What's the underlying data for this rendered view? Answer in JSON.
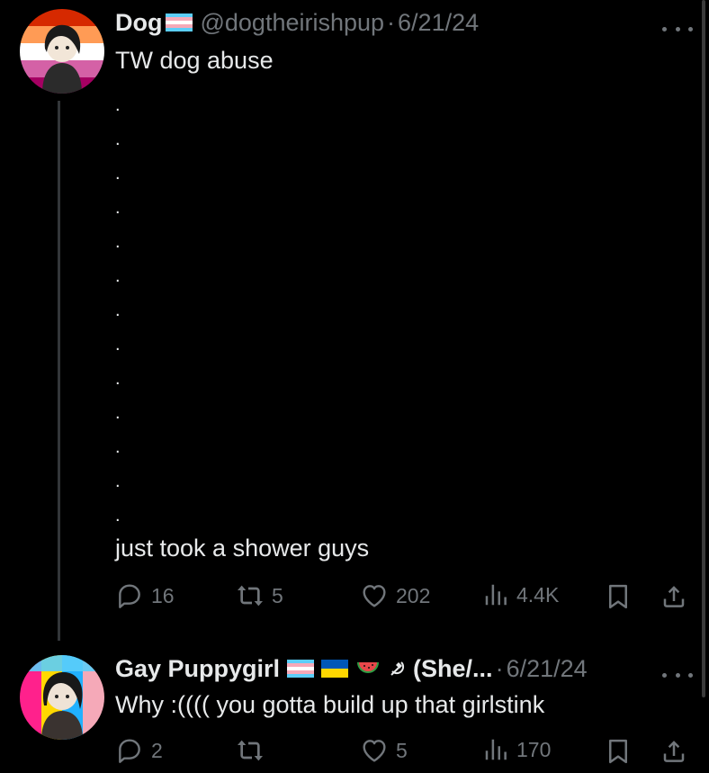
{
  "posts": [
    {
      "display_name": "Dog",
      "handle": "@dogtheirishpup",
      "separator": "·",
      "date": "6/21/24",
      "title_line": "TW dog abuse",
      "spacer_dots": [
        ".",
        ".",
        ".",
        ".",
        ".",
        ".",
        ".",
        ".",
        ".",
        ".",
        ".",
        ".",
        ".",
        "."
      ],
      "body": "just took a shower guys",
      "stats": {
        "replies": "16",
        "reposts": "5",
        "likes": "202",
        "views": "4.4K"
      },
      "name_emojis": [
        "transgender-flag"
      ]
    },
    {
      "display_name": "Gay Puppygirl",
      "name_suffix": "(She/...",
      "separator": "·",
      "date": "6/21/24",
      "body": "Why :(((( you gotta build up that girlstink",
      "stats": {
        "replies": "2",
        "reposts": "",
        "likes": "5",
        "views": "170"
      },
      "name_emojis": [
        "transgender-flag",
        "ukraine-flag",
        "watermelon",
        "hammer-sickle"
      ]
    }
  ],
  "icons": {
    "reply": "reply-icon",
    "repost": "repost-icon",
    "like": "heart-icon",
    "views": "views-chart-icon",
    "bookmark": "bookmark-icon",
    "share": "share-icon",
    "more": "more-options-icon"
  },
  "colors": {
    "background": "#000000",
    "text_primary": "#e7e9ea",
    "text_secondary": "#71767b",
    "thread_line": "#333639"
  }
}
